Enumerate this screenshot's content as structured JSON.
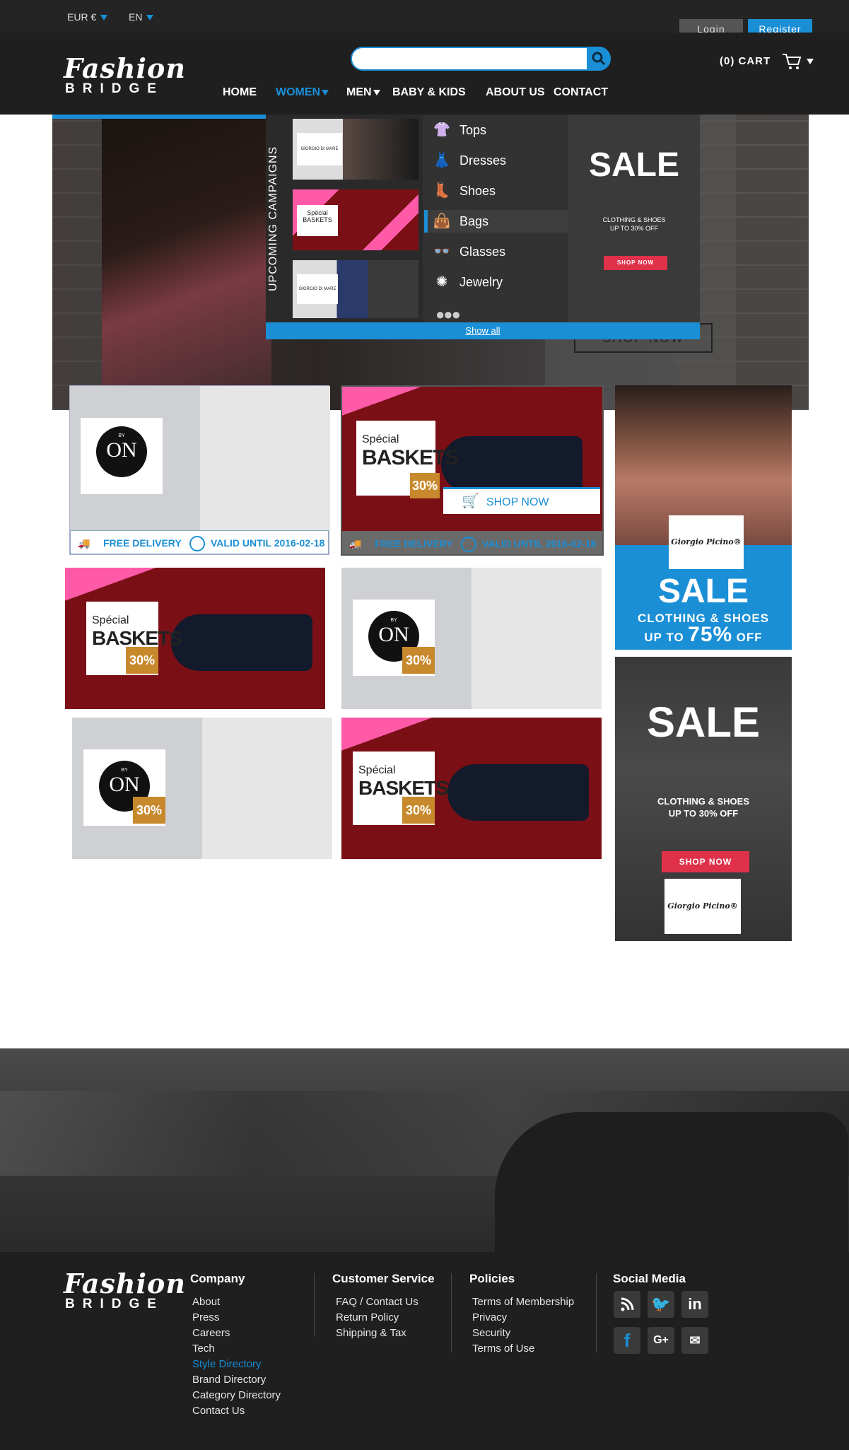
{
  "topbar": {
    "currency": "EUR €",
    "language": "EN",
    "login": "Login",
    "register": "Register"
  },
  "header": {
    "logo_line1": "Fashion",
    "logo_line2": "BRIDGE",
    "search_placeholder": "",
    "cart_label": "(0) CART",
    "nav": [
      {
        "label": "HOME"
      },
      {
        "label": "WOMEN"
      },
      {
        "label": "MEN"
      },
      {
        "label": "BABY & KIDS"
      },
      {
        "label": "ABOUT US"
      },
      {
        "label": "CONTACT"
      }
    ]
  },
  "megamenu": {
    "campaigns_title": "UPCOMING CAMPAIGNS",
    "campaign_logos": [
      "GIORGIO DI MARE",
      "Spécial BASKETS",
      "GIORGIO DI MARE"
    ],
    "categories": [
      {
        "label": "Tops",
        "icon": "top-icon"
      },
      {
        "label": "Dresses",
        "icon": "dress-icon"
      },
      {
        "label": "Shoes",
        "icon": "boot-icon"
      },
      {
        "label": "Bags",
        "icon": "bag-icon"
      },
      {
        "label": "Glasses",
        "icon": "glasses-icon"
      },
      {
        "label": "Jewelry",
        "icon": "ring-icon"
      }
    ],
    "sale_title": "SALE",
    "sale_sub1": "CLOTHING & SHOES",
    "sale_sub2": "UP TO 30% OFF",
    "sale_btn": "SHOP NOW",
    "show_all": "Show all"
  },
  "hero": {
    "shop_now": "SHOP NOW"
  },
  "tiles": {
    "on_logo_by": "BY",
    "on_logo": "ON",
    "baskets_special": "Spécial",
    "baskets_word": "BASKETS",
    "pct": "30%",
    "free_delivery": "FREE DELIVERY",
    "valid_until": "VALID UNTIL 2016-02-18",
    "shop_now": "SHOP NOW"
  },
  "side_ads": {
    "ad1_brand": "Giorgio Picino®",
    "ad1_sale": "SALE",
    "ad1_line1": "CLOTHING & SHOES",
    "ad1_line2_pre": "UP TO",
    "ad1_pct": "75%",
    "ad1_line2_post": "OFF",
    "ad2_sale": "SALE",
    "ad2_line1": "CLOTHING & SHOES",
    "ad2_line2": "UP TO 30% OFF",
    "ad2_btn": "SHOP NOW",
    "ad2_brand": "Giorgio Picino®"
  },
  "footer": {
    "company_title": "Company",
    "company_links": [
      "About",
      "Press",
      "Careers",
      "Tech",
      "Style Directory",
      "Brand Directory",
      "Category Directory",
      "Contact Us"
    ],
    "service_title": "Customer Service",
    "service_links": [
      "FAQ / Contact Us",
      "Return Policy",
      "Shipping & Tax"
    ],
    "policies_title": "Policies",
    "policies_links": [
      "Terms of Membership",
      "Privacy",
      "Security",
      "Terms of Use"
    ],
    "social_title": "Social Media",
    "social_icons": [
      "rss-icon",
      "twitter-icon",
      "linkedin-icon",
      "facebook-icon",
      "google-plus-icon",
      "email-icon"
    ]
  },
  "colors": {
    "accent": "#1a8fd6",
    "dark": "#1f1f1f",
    "sale_red": "#e0314b",
    "gold": "#c8882c",
    "active_link": "#1a8fd6"
  }
}
